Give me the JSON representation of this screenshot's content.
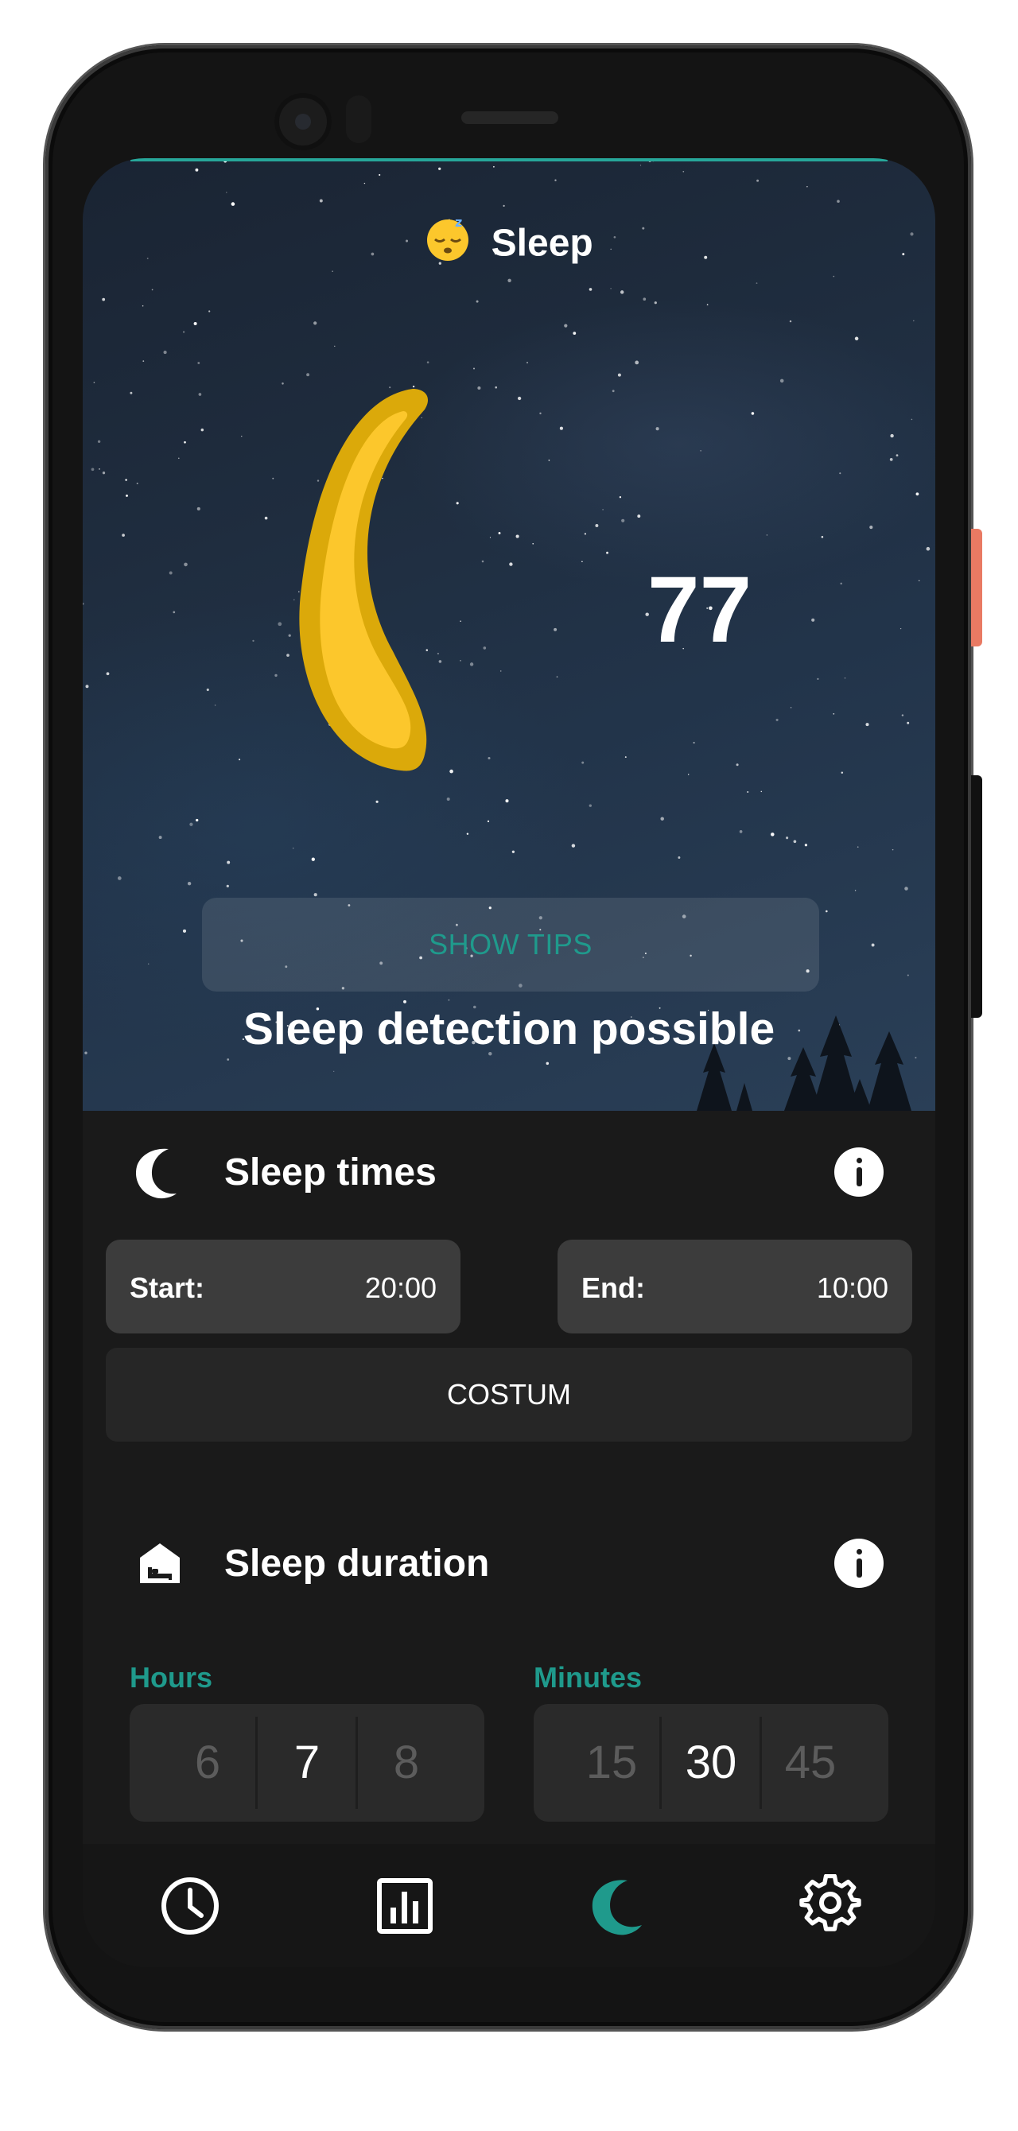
{
  "header": {
    "emoji": "😴",
    "title": "Sleep"
  },
  "score": {
    "value": "77"
  },
  "tips_button": {
    "label": "SHOW TIPS"
  },
  "detection_status": "Sleep detection possible",
  "sleep_times": {
    "title": "Sleep times",
    "start": {
      "label": "Start:",
      "value": "20:00"
    },
    "end": {
      "label": "End:",
      "value": "10:00"
    },
    "custom_button": "COSTUM"
  },
  "sleep_duration": {
    "title": "Sleep duration",
    "hours": {
      "label": "Hours",
      "options": [
        "6",
        "7",
        "8"
      ],
      "selected": "7"
    },
    "minutes": {
      "label": "Minutes",
      "options": [
        "15",
        "30",
        "45"
      ],
      "selected": "30"
    }
  },
  "nav": {
    "items": [
      {
        "icon": "clock-icon",
        "active": false
      },
      {
        "icon": "bar-chart-icon",
        "active": false
      },
      {
        "icon": "moon-icon",
        "active": true
      },
      {
        "icon": "gear-icon",
        "active": false
      }
    ]
  },
  "colors": {
    "accent": "#1f9a8c",
    "moon_outer": "#dba90a",
    "moon_inner": "#fcc72c",
    "panel_bg": "#1a1a1a",
    "box_bg": "#3c3c3c"
  }
}
